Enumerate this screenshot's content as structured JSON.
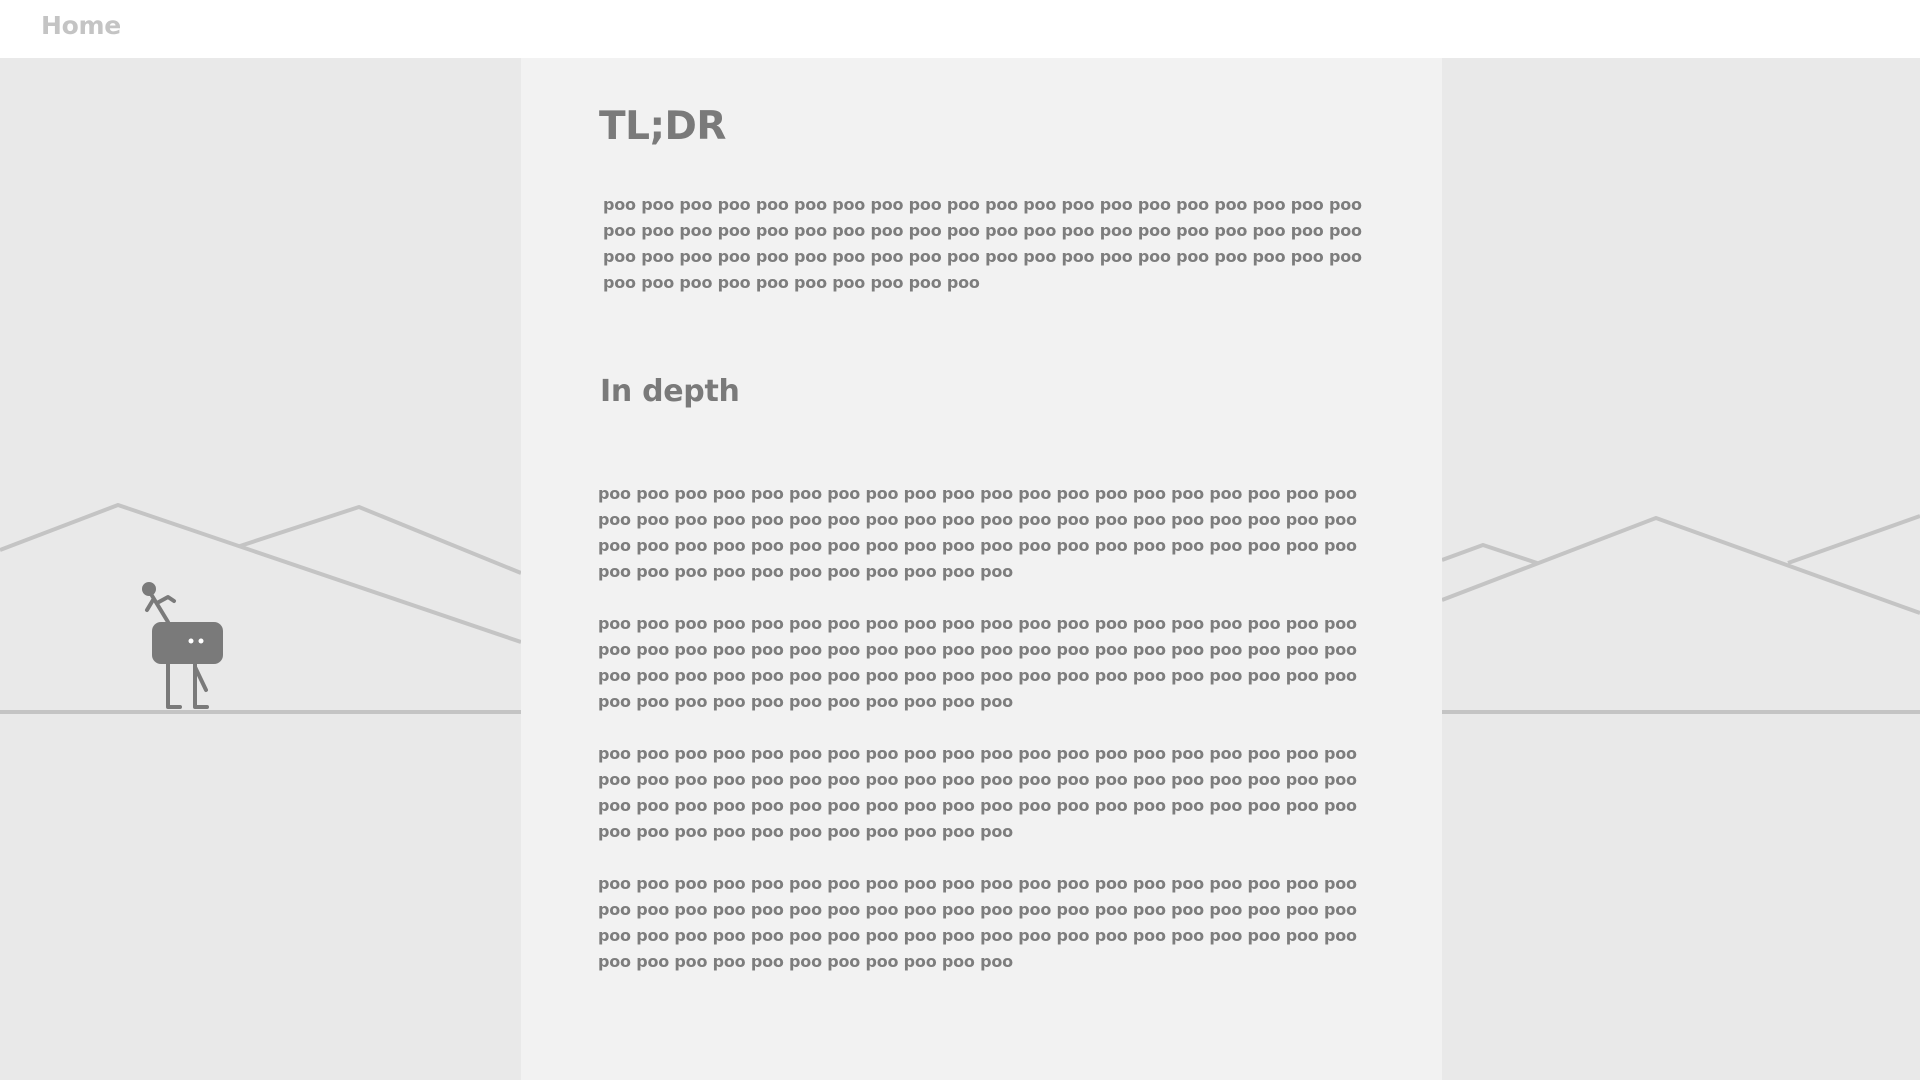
{
  "nav": {
    "home_label": "Home"
  },
  "article": {
    "title": "TL;DR",
    "tldr_text": "poo poo poo poo poo poo poo poo poo poo poo poo poo poo poo poo poo poo poo poo poo poo poo poo poo poo poo poo poo poo poo poo poo poo poo poo poo poo poo poo poo poo poo poo poo poo poo poo poo poo poo poo poo poo poo poo poo poo poo poo poo poo poo poo poo poo poo poo poo poo",
    "section_heading": "In depth",
    "paragraphs": [
      "poo poo poo poo poo poo poo poo poo poo poo poo poo poo poo poo poo poo poo poo poo poo poo poo poo poo poo poo poo poo poo poo poo poo poo poo poo poo poo poo poo poo poo poo poo poo poo poo poo poo poo poo poo poo poo poo poo poo poo poo poo poo poo poo poo poo poo poo poo poo poo",
      "poo poo poo poo poo poo poo poo poo poo poo poo poo poo poo poo poo poo poo poo poo poo poo poo poo poo poo poo poo poo poo poo poo poo poo poo poo poo poo poo poo poo poo poo poo poo poo poo poo poo poo poo poo poo poo poo poo poo poo poo poo poo poo poo poo poo poo poo poo poo poo",
      "poo poo poo poo poo poo poo poo poo poo poo poo poo poo poo poo poo poo poo poo poo poo poo poo poo poo poo poo poo poo poo poo poo poo poo poo poo poo poo poo poo poo poo poo poo poo poo poo poo poo poo poo poo poo poo poo poo poo poo poo poo poo poo poo poo poo poo poo poo poo poo",
      "poo poo poo poo poo poo poo poo poo poo poo poo poo poo poo poo poo poo poo poo poo poo poo poo poo poo poo poo poo poo poo poo poo poo poo poo poo poo poo poo poo poo poo poo poo poo poo poo poo poo poo poo poo poo poo poo poo poo poo poo poo poo poo poo poo poo poo poo poo poo poo"
    ]
  },
  "colors": {
    "page_background": "#e9e9e9",
    "panel_background": "#f2f2f2",
    "topbar_background": "#ffffff",
    "text": "#7a7a7a",
    "nav_text": "#c4c4c4",
    "scenery_lines": "#c4c4c4",
    "robot": "#7a7a7a"
  },
  "scenery": {
    "character_icon": "walking-robot-with-rider-icon"
  }
}
